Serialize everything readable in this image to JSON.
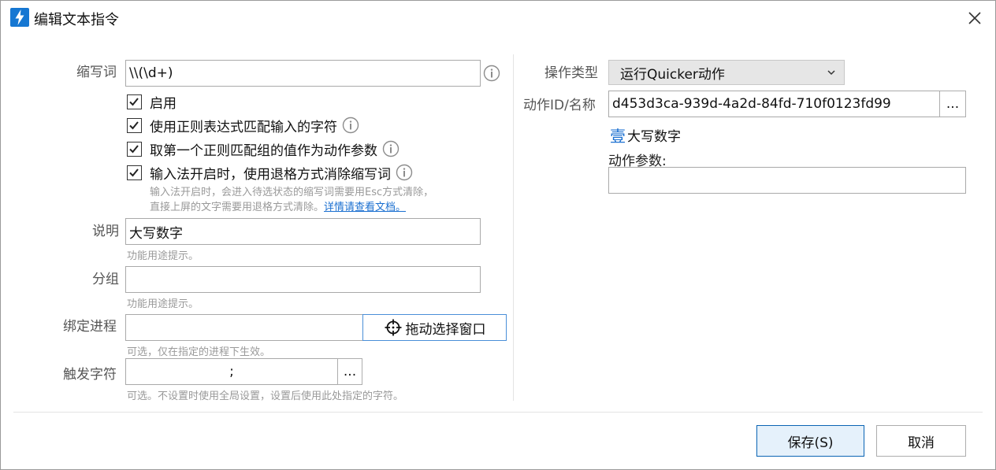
{
  "window": {
    "title": "编辑文本指令",
    "close_glyph": "✕"
  },
  "left": {
    "abbrev": {
      "label": "缩写词",
      "value": "\\\\(\\d+)"
    },
    "checks": [
      {
        "label": "启用",
        "checked": true,
        "info": false
      },
      {
        "label": "使用正则表达式匹配输入的字符",
        "checked": true,
        "info": true
      },
      {
        "label": "取第一个正则匹配组的值作为动作参数",
        "checked": true,
        "info": true
      },
      {
        "label": "输入法开启时，使用退格方式消除缩写词",
        "checked": true,
        "info": true
      }
    ],
    "ime_hint_line1": "输入法开启时，会进入待选状态的缩写词需要用Esc方式清除，",
    "ime_hint_line2": "直接上屏的文字需要用退格方式清除。",
    "ime_hint_link": "详情请查看文档。",
    "desc": {
      "label": "说明",
      "value": "大写数字",
      "hint": "功能用途提示。"
    },
    "group": {
      "label": "分组",
      "value": "",
      "hint": "功能用途提示。"
    },
    "process": {
      "label": "绑定进程",
      "value": "",
      "button": "拖动选择窗口",
      "hint": "可选，仅在指定的进程下生效。"
    },
    "trigger": {
      "label": "触发字符",
      "value": ";",
      "button": "...",
      "hint": "可选。不设置时使用全局设置，设置后使用此处指定的字符。"
    }
  },
  "right": {
    "action_type": {
      "label": "操作类型",
      "value": "运行Quicker动作"
    },
    "action_id": {
      "label": "动作ID/名称",
      "value": "d453d3ca-939d-4a2d-84fd-710f0123fd99",
      "button": "..."
    },
    "action_name": {
      "glyph": "壹",
      "text": "大写数字"
    },
    "action_params": {
      "label": "动作参数:",
      "value": ""
    }
  },
  "footer": {
    "save": "保存(S)",
    "cancel": "取消"
  },
  "icons": {
    "app": "lightning-icon",
    "info": "info-icon",
    "crosshair": "crosshair-icon",
    "chevron": "chevron-down-icon",
    "check": "checkmark-icon"
  },
  "colors": {
    "accent": "#1677d2",
    "link": "#1a6fd0",
    "primary_border": "#0a64b4",
    "primary_bg": "#e5f1fb"
  }
}
